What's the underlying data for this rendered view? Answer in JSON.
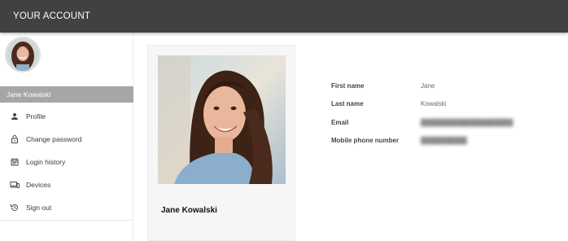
{
  "header": {
    "title": "YOUR ACCOUNT"
  },
  "sidebar": {
    "user_name": "Jane Kowalski",
    "items": [
      {
        "label": "Profile",
        "icon": "person-icon"
      },
      {
        "label": "Change password",
        "icon": "lock-icon"
      },
      {
        "label": "Login history",
        "icon": "calendar-icon"
      },
      {
        "label": "Devices",
        "icon": "devices-icon"
      },
      {
        "label": "Sign out",
        "icon": "history-icon"
      }
    ]
  },
  "profile_card": {
    "name": "Jane Kowalski"
  },
  "details": [
    {
      "label": "First name",
      "value": "Jane"
    },
    {
      "label": "Last name",
      "value": "Kowalski"
    },
    {
      "label": "Email",
      "value": "",
      "blurred": true
    },
    {
      "label": "Mobile phone number",
      "value": "",
      "blurred": true
    }
  ]
}
